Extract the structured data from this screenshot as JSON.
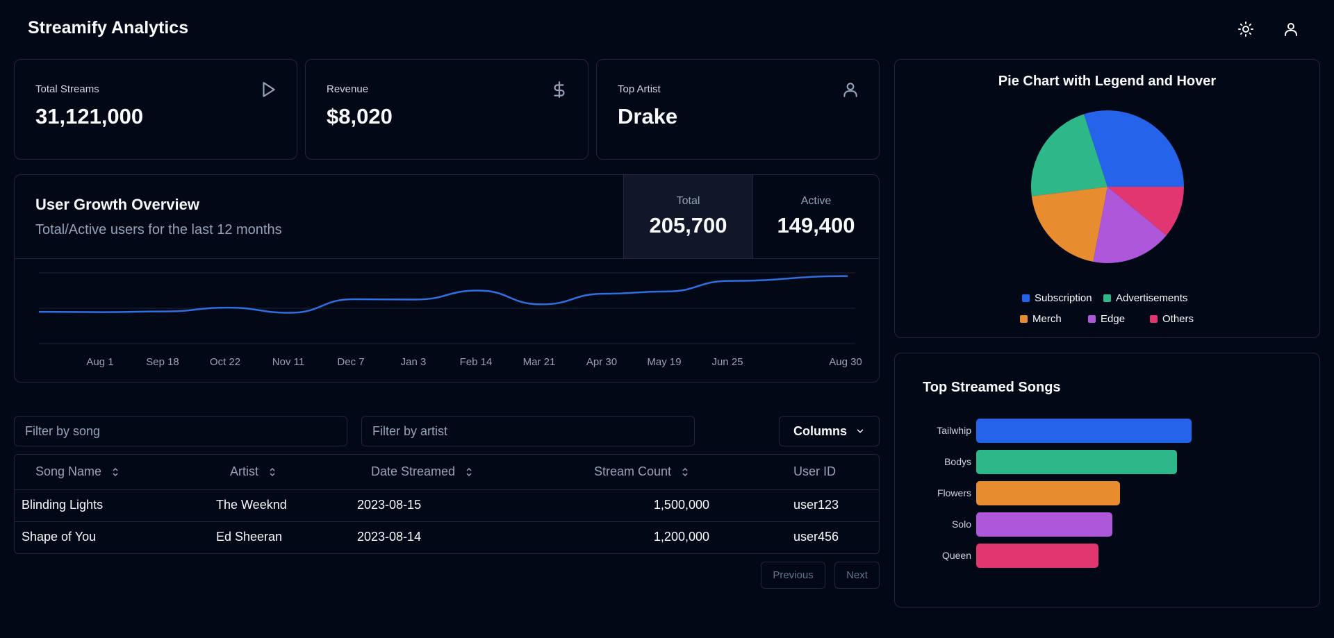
{
  "app": {
    "title": "Streamify Analytics"
  },
  "header": {
    "theme_icon": "sun-icon",
    "user_icon": "user-icon"
  },
  "stats": [
    {
      "label": "Total Streams",
      "value": "31,121,000",
      "icon": "play-icon"
    },
    {
      "label": "Revenue",
      "value": "$8,020",
      "icon": "dollar-icon"
    },
    {
      "label": "Top Artist",
      "value": "Drake",
      "icon": "user-icon"
    }
  ],
  "growth": {
    "title": "User Growth Overview",
    "subtitle": "Total/Active users for the last 12 months",
    "total_label": "Total",
    "total_value": "205,700",
    "active_label": "Active",
    "active_value": "149,400",
    "line_color": "#2f6fe0"
  },
  "filters": {
    "song_placeholder": "Filter by song",
    "artist_placeholder": "Filter by artist",
    "columns_label": "Columns"
  },
  "table": {
    "headers": [
      "Song Name",
      "Artist",
      "Date Streamed",
      "Stream Count",
      "User ID"
    ],
    "rows": [
      [
        "Blinding Lights",
        "The Weeknd",
        "2023-08-15",
        "1,500,000",
        "user123"
      ],
      [
        "Shape of You",
        "Ed Sheeran",
        "2023-08-14",
        "1,200,000",
        "user456"
      ]
    ]
  },
  "pagination": {
    "previous_label": "Previous",
    "next_label": "Next"
  },
  "pie": {
    "title": "Pie Chart with Legend and Hover",
    "legend": [
      "Subscription",
      "Advertisements",
      "Merch",
      "Edge",
      "Others"
    ]
  },
  "songs": {
    "title": "Top Streamed Songs"
  },
  "chart_data": [
    {
      "type": "line",
      "x": [
        "Aug 1",
        "Sep 18",
        "Oct 22",
        "Nov 11",
        "Dec 7",
        "Jan 3",
        "Feb 14",
        "Mar 21",
        "Apr 30",
        "May 19",
        "Jun 25",
        "Aug 30"
      ],
      "x_extra_ticks": [],
      "series": [
        {
          "name": "",
          "values": [
            9800,
            10000,
            11200,
            9600,
            13800,
            13700,
            16500,
            12200,
            15500,
            16200,
            19500,
            21000
          ]
        }
      ],
      "grid": true
    },
    {
      "type": "pie",
      "labels": [
        "Subscription",
        "Advertisements",
        "Merch",
        "Edge",
        "Others"
      ],
      "values": [
        30,
        22,
        20,
        17,
        11
      ],
      "colors": [
        "#2563eb",
        "#2eb88a",
        "#e88c30",
        "#af57db",
        "#e23670"
      ],
      "legend": "bottom"
    },
    {
      "type": "bar",
      "orientation": "horizontal",
      "categories": [
        "Tailwhip",
        "Bodys",
        "Flowers",
        "Solo",
        "Queen"
      ],
      "values": [
        310,
        289,
        207,
        196,
        176
      ],
      "colors": [
        "#2563eb",
        "#2eb88a",
        "#e88c30",
        "#af57db",
        "#e23670"
      ]
    }
  ]
}
